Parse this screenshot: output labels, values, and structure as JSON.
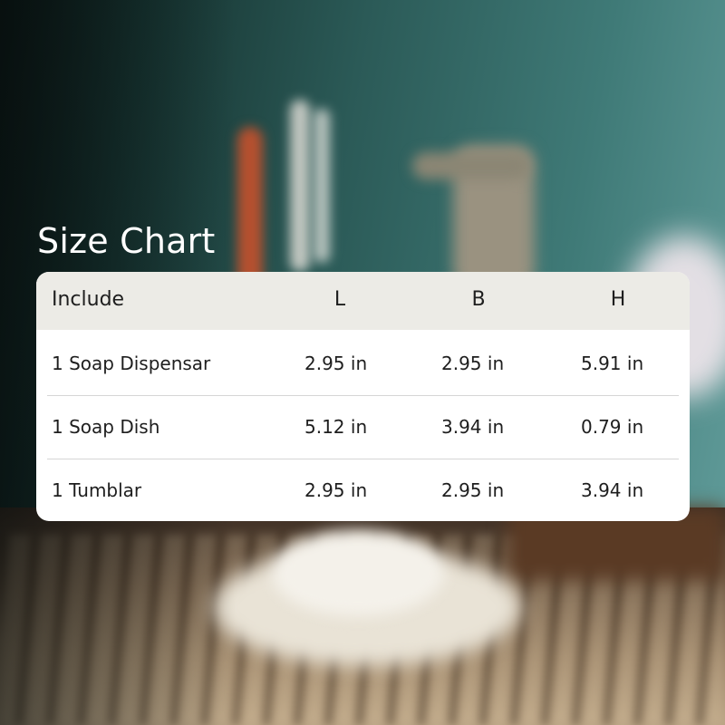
{
  "title": "Size Chart",
  "table": {
    "headers": [
      "Include",
      "L",
      "B",
      "H"
    ],
    "rows": [
      [
        "1 Soap Dispensar",
        "2.95 in",
        "2.95 in",
        "5.91 in"
      ],
      [
        "1 Soap Dish",
        "5.12 in",
        "3.94 in",
        "0.79 in"
      ],
      [
        "1 Tumblar",
        "2.95 in",
        "2.95 in",
        "3.94 in"
      ]
    ]
  },
  "colors": {
    "header_bg": "#ecebe6",
    "table_bg": "#ffffff",
    "title_text": "#ffffff",
    "body_text": "#1e1e1e"
  }
}
